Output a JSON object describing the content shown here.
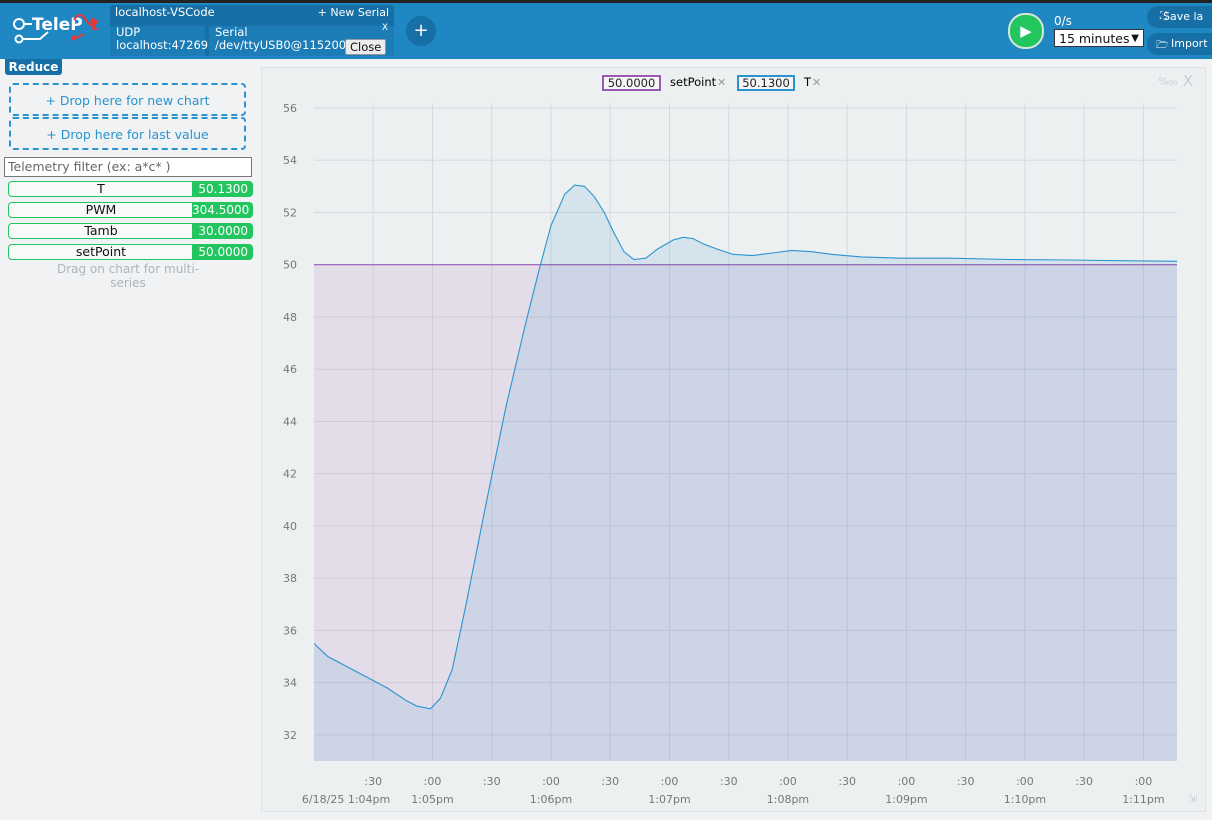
{
  "app": {
    "logo_text": "TeleP"
  },
  "connection": {
    "title": "localhost-VSCode",
    "new_serial": "+ New Serial",
    "udp_label": "UDP",
    "udp_addr": "localhost:47269",
    "serial_label": "Serial",
    "serial_addr": "/dev/ttyUSB0@115200",
    "close_label": "Close",
    "remove_label": "X",
    "add_label": "+"
  },
  "controls": {
    "rate": "0/s",
    "range_selected": "15 minutes",
    "save_label": "Save la",
    "import_label": "Import la"
  },
  "sidebar": {
    "reduce_label": "Reduce",
    "drop_new_chart": "+ Drop here for new chart",
    "drop_last_value": "+ Drop here for last value",
    "filter_placeholder": "Telemetry filter (ex: a*c* )",
    "telemetry": [
      {
        "name": "T",
        "value": "50.1300"
      },
      {
        "name": "PWM",
        "value": "304.5000"
      },
      {
        "name": "Tamb",
        "value": "30.0000"
      },
      {
        "name": "setPoint",
        "value": "50.0000"
      }
    ],
    "hint": "Drag on chart for multi-series"
  },
  "chart_legend": [
    {
      "value": "50.0000",
      "name": "setPoint",
      "color": "#9b59b6"
    },
    {
      "value": "50.1300",
      "name": "T",
      "color": "#2b93cf"
    }
  ],
  "chart_corner": {
    "percent": "%₀₀",
    "close": "X"
  },
  "chart_data": {
    "type": "area",
    "ylim": [
      31,
      56
    ],
    "yticks": [
      32,
      34,
      36,
      38,
      40,
      42,
      44,
      46,
      48,
      50,
      52,
      54,
      56
    ],
    "xlim": [
      -32,
      405
    ],
    "xticks_top": [
      ":30",
      ":00",
      ":30",
      ":00",
      ":30",
      ":00",
      ":30",
      ":00",
      ":30",
      ":00",
      ":30",
      ":00",
      ":30",
      ":00"
    ],
    "xticks_top_t": [
      -2,
      28,
      58,
      88,
      118,
      148,
      178,
      208,
      238,
      268,
      298,
      328,
      358,
      388
    ],
    "xticks_bottom": [
      "6/18/25 1:04pm",
      "1:05pm",
      "1:06pm",
      "1:07pm",
      "1:08pm",
      "1:09pm",
      "1:10pm",
      "1:11pm"
    ],
    "xticks_bottom_t": [
      -2,
      28,
      88,
      148,
      208,
      268,
      328,
      388
    ],
    "series": [
      {
        "name": "setPoint",
        "color": "#9b59b6",
        "points": [
          [
            -32,
            50
          ],
          [
            405,
            50
          ]
        ]
      },
      {
        "name": "T",
        "color": "#2b93cf",
        "points": [
          [
            -32,
            35.5
          ],
          [
            -25,
            35
          ],
          [
            -15,
            34.6
          ],
          [
            -5,
            34.2
          ],
          [
            5,
            33.8
          ],
          [
            15,
            33.3
          ],
          [
            20,
            33.1
          ],
          [
            27,
            33.0
          ],
          [
            32,
            33.4
          ],
          [
            38,
            34.5
          ],
          [
            45,
            37
          ],
          [
            55,
            40.8
          ],
          [
            65,
            44.5
          ],
          [
            75,
            47.7
          ],
          [
            82,
            49.8
          ],
          [
            88,
            51.5
          ],
          [
            95,
            52.7
          ],
          [
            100,
            53.05
          ],
          [
            105,
            53.0
          ],
          [
            110,
            52.6
          ],
          [
            115,
            52
          ],
          [
            120,
            51.2
          ],
          [
            125,
            50.5
          ],
          [
            130,
            50.2
          ],
          [
            136,
            50.25
          ],
          [
            142,
            50.6
          ],
          [
            150,
            50.95
          ],
          [
            155,
            51.05
          ],
          [
            160,
            51.0
          ],
          [
            165,
            50.8
          ],
          [
            172,
            50.6
          ],
          [
            180,
            50.4
          ],
          [
            190,
            50.35
          ],
          [
            200,
            50.45
          ],
          [
            210,
            50.55
          ],
          [
            220,
            50.5
          ],
          [
            230,
            50.4
          ],
          [
            245,
            50.3
          ],
          [
            265,
            50.25
          ],
          [
            290,
            50.25
          ],
          [
            320,
            50.2
          ],
          [
            350,
            50.18
          ],
          [
            380,
            50.15
          ],
          [
            405,
            50.13
          ]
        ]
      }
    ]
  }
}
